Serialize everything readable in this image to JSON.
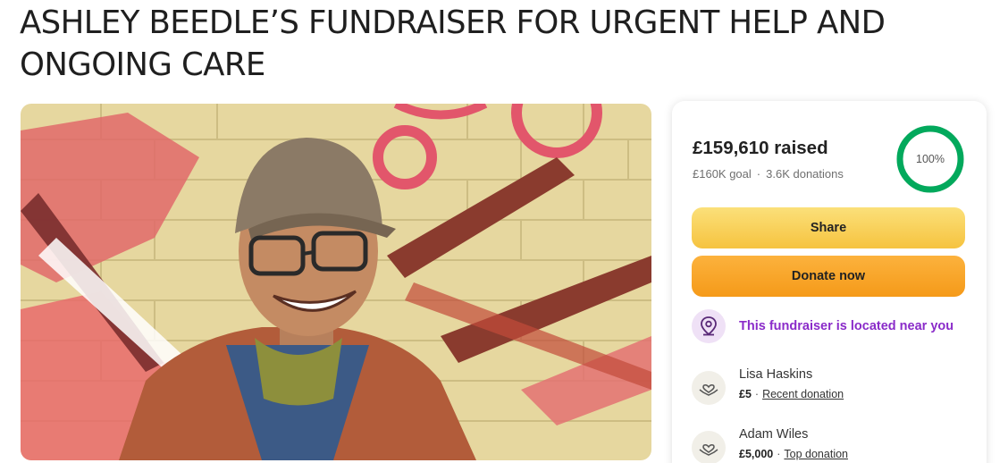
{
  "page": {
    "title": "ASHLEY BEEDLE’S FUNDRAISER FOR URGENT HELP AND ONGOING CARE"
  },
  "colors": {
    "accent_green": "#02a95c",
    "share_button": "#f8cf55",
    "donate_button": "#f7a42a",
    "location_purple": "#8a2bc9"
  },
  "hero": {
    "image_icon": "photo-of-smiling-man-in-cap-against-graffiti-wall"
  },
  "progress": {
    "raised": "£159,610 raised",
    "goal": "£160K goal",
    "separator": "·",
    "donations": "3.6K donations",
    "percent_label": "100%",
    "percent_value": 1.0
  },
  "buttons": {
    "share": "Share",
    "donate": "Donate now"
  },
  "location": {
    "icon": "map-pin-icon",
    "text": "This fundraiser is located near you"
  },
  "donations": [
    {
      "icon": "heart-hands-icon",
      "name": "Lisa Haskins",
      "amount": "£5",
      "sep": "·",
      "tag": "Recent donation"
    },
    {
      "icon": "heart-hands-icon",
      "name": "Adam Wiles",
      "amount": "£5,000",
      "sep": "·",
      "tag": "Top donation"
    }
  ]
}
